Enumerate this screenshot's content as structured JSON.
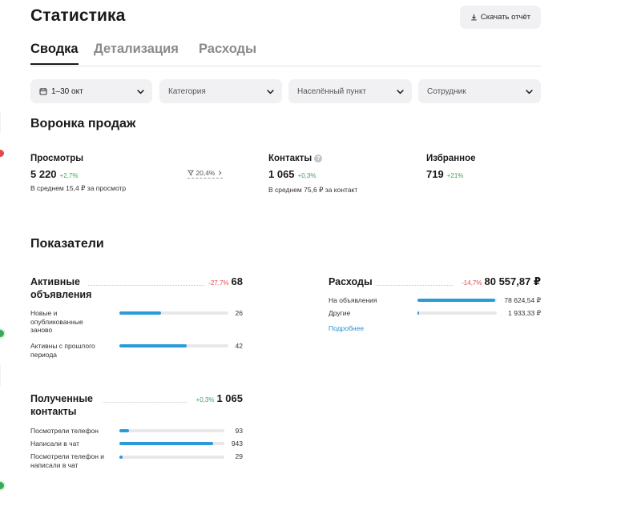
{
  "header": {
    "title": "Статистика",
    "download_label": "Скачать отчёт"
  },
  "tabs": [
    {
      "label": "Сводка",
      "active": true
    },
    {
      "label": "Детализация",
      "active": false
    },
    {
      "label": "Расходы",
      "active": false
    }
  ],
  "filters": {
    "date": "1–30 окт",
    "category": "Категория",
    "location": "Населённый пункт",
    "employee": "Сотрудник"
  },
  "funnel": {
    "title": "Воронка продаж",
    "conversion": "20,4%",
    "views": {
      "label": "Просмотры",
      "value": "5 220",
      "delta": "+2,7%",
      "note": "В среднем 15,4 ₽ за просмотр"
    },
    "contacts": {
      "label": "Контакты",
      "value": "1 065",
      "delta": "+0,3%",
      "note": "В среднем 75,6 ₽ за контакт"
    },
    "favorites": {
      "label": "Избранное",
      "value": "719",
      "delta": "+21%"
    }
  },
  "indicators": {
    "title": "Показатели",
    "active_ads": {
      "title": "Активные объявления",
      "delta": "-27,7%",
      "total": "68",
      "rows": [
        {
          "label": "Новые и опубликованные заново",
          "value": "26",
          "fraction": 0.38
        },
        {
          "label": "Активны с прошлого периода",
          "value": "42",
          "fraction": 0.62
        }
      ]
    },
    "contacts": {
      "title": "Полученные контакты",
      "delta": "+0,3%",
      "total": "1 065",
      "rows": [
        {
          "label": "Посмотрели телефон",
          "value": "93",
          "fraction": 0.09
        },
        {
          "label": "Написали в чат",
          "value": "943",
          "fraction": 0.89
        },
        {
          "label": "Посмотрели телефон и написали в чат",
          "value": "29",
          "fraction": 0.03
        }
      ]
    },
    "expenses": {
      "title": "Расходы",
      "delta": "-14,7%",
      "total": "80 557,87 ₽",
      "rows": [
        {
          "label": "На объявления",
          "value": "78 624,54 ₽",
          "fraction": 0.976
        },
        {
          "label": "Другие",
          "value": "1 933,33 ₽",
          "fraction": 0.024
        }
      ],
      "more_link": "Подробнее"
    }
  },
  "colors": {
    "accent_bar": "#2a9ad8",
    "positive": "#3aa857",
    "negative": "#e5484d",
    "link": "#2a8fd4"
  }
}
